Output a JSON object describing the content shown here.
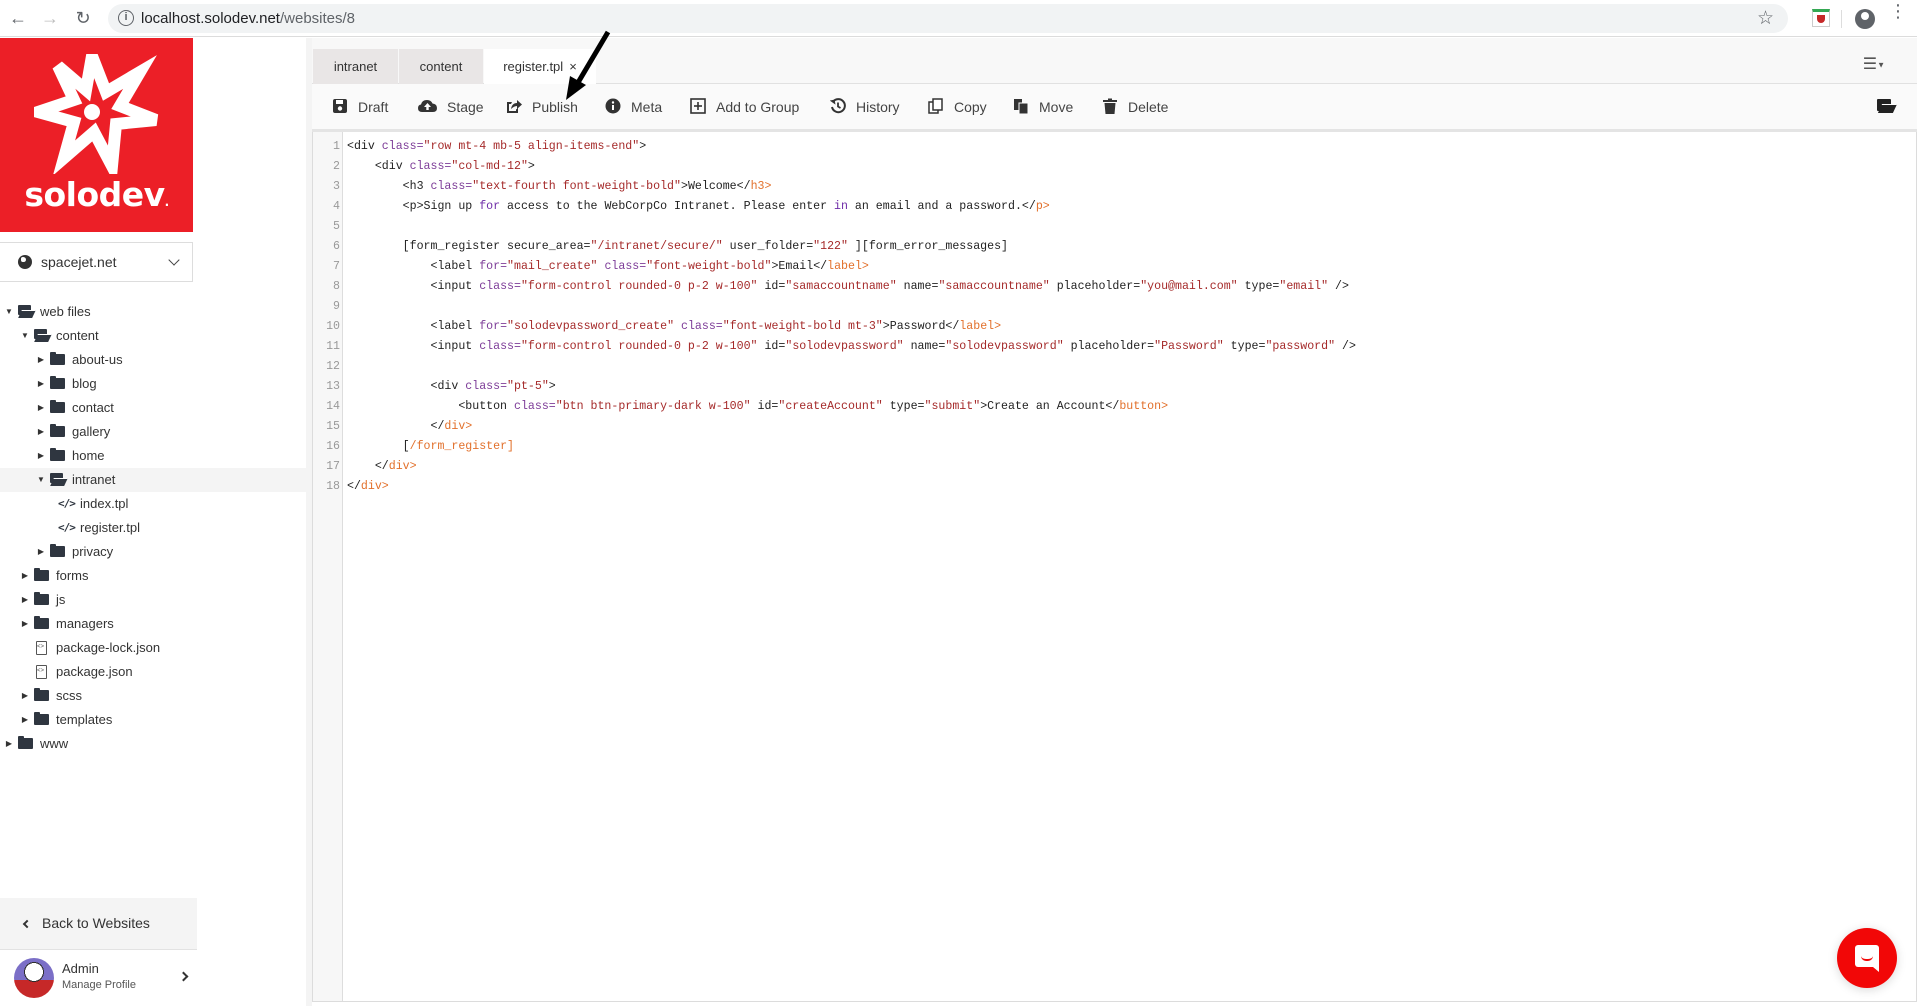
{
  "browser": {
    "url_host": "localhost.solodev.net",
    "url_path": "/websites/8"
  },
  "sidebar": {
    "logo_text": "solodev",
    "site_selector": "spacejet.net",
    "tree": [
      {
        "label": "web files",
        "type": "folder",
        "depth": 0,
        "expanded": true
      },
      {
        "label": "content",
        "type": "folder",
        "depth": 1,
        "expanded": true
      },
      {
        "label": "about-us",
        "type": "folder",
        "depth": 2,
        "expanded": false
      },
      {
        "label": "blog",
        "type": "folder",
        "depth": 2,
        "expanded": false
      },
      {
        "label": "contact",
        "type": "folder",
        "depth": 2,
        "expanded": false
      },
      {
        "label": "gallery",
        "type": "folder",
        "depth": 2,
        "expanded": false
      },
      {
        "label": "home",
        "type": "folder",
        "depth": 2,
        "expanded": false
      },
      {
        "label": "intranet",
        "type": "folder",
        "depth": 2,
        "expanded": true,
        "selected": true
      },
      {
        "label": "index.tpl",
        "type": "code",
        "depth": 3
      },
      {
        "label": "register.tpl",
        "type": "code",
        "depth": 3
      },
      {
        "label": "privacy",
        "type": "folder",
        "depth": 2,
        "expanded": false
      },
      {
        "label": "forms",
        "type": "folder",
        "depth": 1,
        "expanded": false
      },
      {
        "label": "js",
        "type": "folder",
        "depth": 1,
        "expanded": false
      },
      {
        "label": "managers",
        "type": "folder",
        "depth": 1,
        "expanded": false
      },
      {
        "label": "package-lock.json",
        "type": "json",
        "depth": 1
      },
      {
        "label": "package.json",
        "type": "json",
        "depth": 1
      },
      {
        "label": "scss",
        "type": "folder",
        "depth": 1,
        "expanded": false
      },
      {
        "label": "templates",
        "type": "folder",
        "depth": 1,
        "expanded": false
      },
      {
        "label": "www",
        "type": "folder",
        "depth": 0,
        "expanded": false
      }
    ],
    "back_label": "Back to Websites",
    "profile": {
      "name": "Admin",
      "subtitle": "Manage Profile"
    }
  },
  "tabs": [
    {
      "label": "intranet",
      "active": false
    },
    {
      "label": "content",
      "active": false
    },
    {
      "label": "register.tpl",
      "active": true,
      "closable": true
    }
  ],
  "tab_close_glyph": "×",
  "toolbar": {
    "buttons": [
      {
        "label": "Draft",
        "icon": "save-icon"
      },
      {
        "label": "Stage",
        "icon": "cloud-upload-icon"
      },
      {
        "label": "Publish",
        "icon": "share-icon"
      },
      {
        "label": "Meta",
        "icon": "info-icon"
      },
      {
        "label": "Add to Group",
        "icon": "plus-square-icon"
      },
      {
        "label": "History",
        "icon": "history-icon"
      },
      {
        "label": "Copy",
        "icon": "copy-icon"
      },
      {
        "label": "Move",
        "icon": "move-icon"
      },
      {
        "label": "Delete",
        "icon": "trash-icon"
      }
    ]
  },
  "editor": {
    "lines": [
      [
        [
          "tag",
          "<div "
        ],
        [
          "attr",
          "class="
        ],
        [
          "str",
          "\"row mt-4 mb-5 align-items-end\""
        ],
        [
          "tag",
          ">"
        ]
      ],
      [
        [
          "tag",
          "    <div "
        ],
        [
          "attr",
          "class="
        ],
        [
          "str",
          "\"col-md-12\""
        ],
        [
          "tag",
          ">"
        ]
      ],
      [
        [
          "tag",
          "        <h3 "
        ],
        [
          "attr",
          "class="
        ],
        [
          "str",
          "\"text-fourth font-weight-bold\""
        ],
        [
          "tag",
          ">Welcome"
        ],
        [
          "tag",
          "</"
        ],
        [
          "close",
          "h3>"
        ]
      ],
      [
        [
          "tag",
          "        <p>Sign up "
        ],
        [
          "kw",
          "for"
        ],
        [
          "tag",
          " access to the WebCorpCo Intranet. Please enter "
        ],
        [
          "kw",
          "in"
        ],
        [
          "tag",
          " an email and a password."
        ],
        [
          "tag",
          "</"
        ],
        [
          "close",
          "p>"
        ]
      ],
      [],
      [
        [
          "tag",
          "        [form_register secure_area="
        ],
        [
          "str",
          "\"/intranet/secure/\""
        ],
        [
          "tag",
          " user_folder="
        ],
        [
          "str",
          "\"122\""
        ],
        [
          "tag",
          " ][form_error_messages]"
        ]
      ],
      [
        [
          "tag",
          "            <label "
        ],
        [
          "attr",
          "for="
        ],
        [
          "str",
          "\"mail_create\""
        ],
        [
          "tag",
          " "
        ],
        [
          "attr",
          "class="
        ],
        [
          "str",
          "\"font-weight-bold\""
        ],
        [
          "tag",
          ">Email"
        ],
        [
          "tag",
          "</"
        ],
        [
          "close",
          "label>"
        ]
      ],
      [
        [
          "tag",
          "            <input "
        ],
        [
          "attr",
          "class="
        ],
        [
          "str",
          "\"form-control rounded-0 p-2 w-100\""
        ],
        [
          "tag",
          " id="
        ],
        [
          "str",
          "\"samaccountname\""
        ],
        [
          "tag",
          " name="
        ],
        [
          "str",
          "\"samaccountname\""
        ],
        [
          "tag",
          " placeholder="
        ],
        [
          "str",
          "\"you@mail.com\""
        ],
        [
          "tag",
          " type="
        ],
        [
          "str",
          "\"email\""
        ],
        [
          "tag",
          " />"
        ]
      ],
      [],
      [
        [
          "tag",
          "            <label "
        ],
        [
          "attr",
          "for="
        ],
        [
          "str",
          "\"solodevpassword_create\""
        ],
        [
          "tag",
          " "
        ],
        [
          "attr",
          "class="
        ],
        [
          "str",
          "\"font-weight-bold mt-3\""
        ],
        [
          "tag",
          ">Password"
        ],
        [
          "tag",
          "</"
        ],
        [
          "close",
          "label>"
        ]
      ],
      [
        [
          "tag",
          "            <input "
        ],
        [
          "attr",
          "class="
        ],
        [
          "str",
          "\"form-control rounded-0 p-2 w-100\""
        ],
        [
          "tag",
          " id="
        ],
        [
          "str",
          "\"solodevpassword\""
        ],
        [
          "tag",
          " name="
        ],
        [
          "str",
          "\"solodevpassword\""
        ],
        [
          "tag",
          " placeholder="
        ],
        [
          "str",
          "\"Password\""
        ],
        [
          "tag",
          " type="
        ],
        [
          "str",
          "\"password\""
        ],
        [
          "tag",
          " />"
        ]
      ],
      [],
      [
        [
          "tag",
          "            <div "
        ],
        [
          "attr",
          "class="
        ],
        [
          "str",
          "\"pt-5\""
        ],
        [
          "tag",
          ">"
        ]
      ],
      [
        [
          "tag",
          "                <button "
        ],
        [
          "attr",
          "class="
        ],
        [
          "str",
          "\"btn btn-primary-dark w-100\""
        ],
        [
          "tag",
          " id="
        ],
        [
          "str",
          "\"createAccount\""
        ],
        [
          "tag",
          " type="
        ],
        [
          "str",
          "\"submit\""
        ],
        [
          "tag",
          ">Create an Account"
        ],
        [
          "tag",
          "</"
        ],
        [
          "close",
          "button>"
        ]
      ],
      [
        [
          "tag",
          "            </"
        ],
        [
          "close",
          "div>"
        ]
      ],
      [
        [
          "tag",
          "        ["
        ],
        [
          "close",
          "/form_register]"
        ]
      ],
      [
        [
          "tag",
          "    </"
        ],
        [
          "close",
          "div>"
        ]
      ],
      [
        [
          "tag",
          "</"
        ],
        [
          "close",
          "div>"
        ]
      ]
    ]
  },
  "colors": {
    "brand_red": "#ec1f27",
    "chat_red": "#f20707"
  }
}
